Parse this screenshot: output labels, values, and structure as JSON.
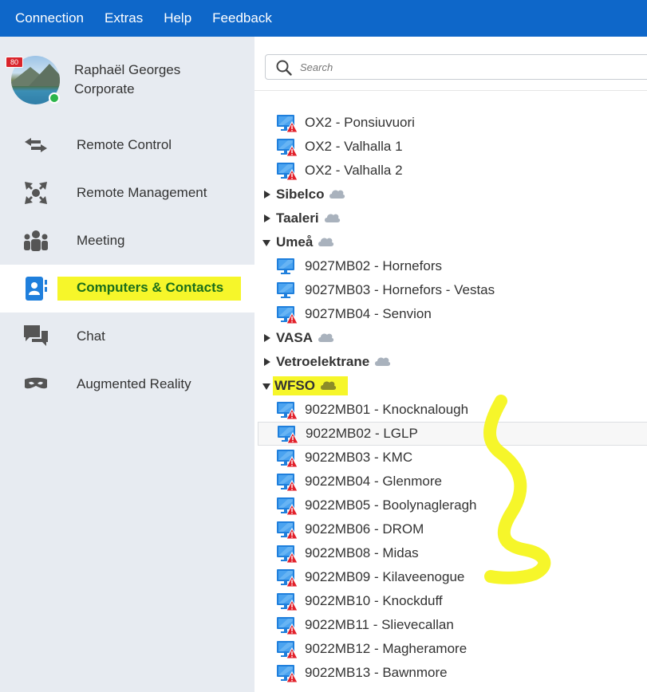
{
  "menu": [
    "Connection",
    "Extras",
    "Help",
    "Feedback"
  ],
  "profile": {
    "badge": "80",
    "name": "Raphaël Georges",
    "role": "Corporate"
  },
  "nav": [
    {
      "label": "Remote Control",
      "icon": "arrows-swap-icon"
    },
    {
      "label": "Remote Management",
      "icon": "expand-arrows-icon"
    },
    {
      "label": "Meeting",
      "icon": "people-icon"
    },
    {
      "label": "Computers & Contacts",
      "icon": "contacts-book-icon",
      "active": true
    },
    {
      "label": "Chat",
      "icon": "chat-bubbles-icon"
    },
    {
      "label": "Augmented Reality",
      "icon": "ar-glasses-icon"
    }
  ],
  "search": {
    "placeholder": "Search"
  },
  "tree": [
    {
      "type": "computer",
      "label": "OX2 - Ponsiuvuori",
      "warning": true
    },
    {
      "type": "computer",
      "label": "OX2 - Valhalla 1",
      "warning": true
    },
    {
      "type": "computer",
      "label": "OX2 - Valhalla 2",
      "warning": true
    },
    {
      "type": "group",
      "label": "Sibelco",
      "expanded": false
    },
    {
      "type": "group",
      "label": "Taaleri",
      "expanded": false
    },
    {
      "type": "group",
      "label": "Umeå",
      "expanded": true
    },
    {
      "type": "computer",
      "label": "9027MB02 - Hornefors",
      "warning": false
    },
    {
      "type": "computer",
      "label": "9027MB03 - Hornefors - Vestas",
      "warning": false
    },
    {
      "type": "computer",
      "label": "9027MB04 - Senvion",
      "warning": true
    },
    {
      "type": "group",
      "label": "VASA",
      "expanded": false
    },
    {
      "type": "group",
      "label": "Vetroelektrane",
      "expanded": false
    },
    {
      "type": "group",
      "label": "WFSO",
      "expanded": true,
      "highlight": true
    },
    {
      "type": "computer",
      "label": "9022MB01 - Knocknalough",
      "warning": true
    },
    {
      "type": "computer",
      "label": "9022MB02 - LGLP",
      "warning": true,
      "selected": true
    },
    {
      "type": "computer",
      "label": "9022MB03 - KMC",
      "warning": true
    },
    {
      "type": "computer",
      "label": "9022MB04 - Glenmore",
      "warning": true
    },
    {
      "type": "computer",
      "label": "9022MB05 - Boolynagleragh",
      "warning": true
    },
    {
      "type": "computer",
      "label": "9022MB06 - DROM",
      "warning": true
    },
    {
      "type": "computer",
      "label": "9022MB08 - Midas",
      "warning": true
    },
    {
      "type": "computer",
      "label": "9022MB09 - Kilaveenogue",
      "warning": true
    },
    {
      "type": "computer",
      "label": "9022MB10 - Knockduff",
      "warning": true
    },
    {
      "type": "computer",
      "label": "9022MB11 - Slievecallan",
      "warning": true
    },
    {
      "type": "computer",
      "label": "9022MB12 - Magheramore",
      "warning": true
    },
    {
      "type": "computer",
      "label": "9022MB13 - Bawnmore",
      "warning": true
    }
  ],
  "colors": {
    "menubar": "#0e67c9",
    "sidebar": "#e7ebf1",
    "highlight": "#f6f62a",
    "active_text": "#1a6e1a",
    "warning": "#e2202a",
    "monitor": "#1f7fdc",
    "online": "#2db54b"
  }
}
